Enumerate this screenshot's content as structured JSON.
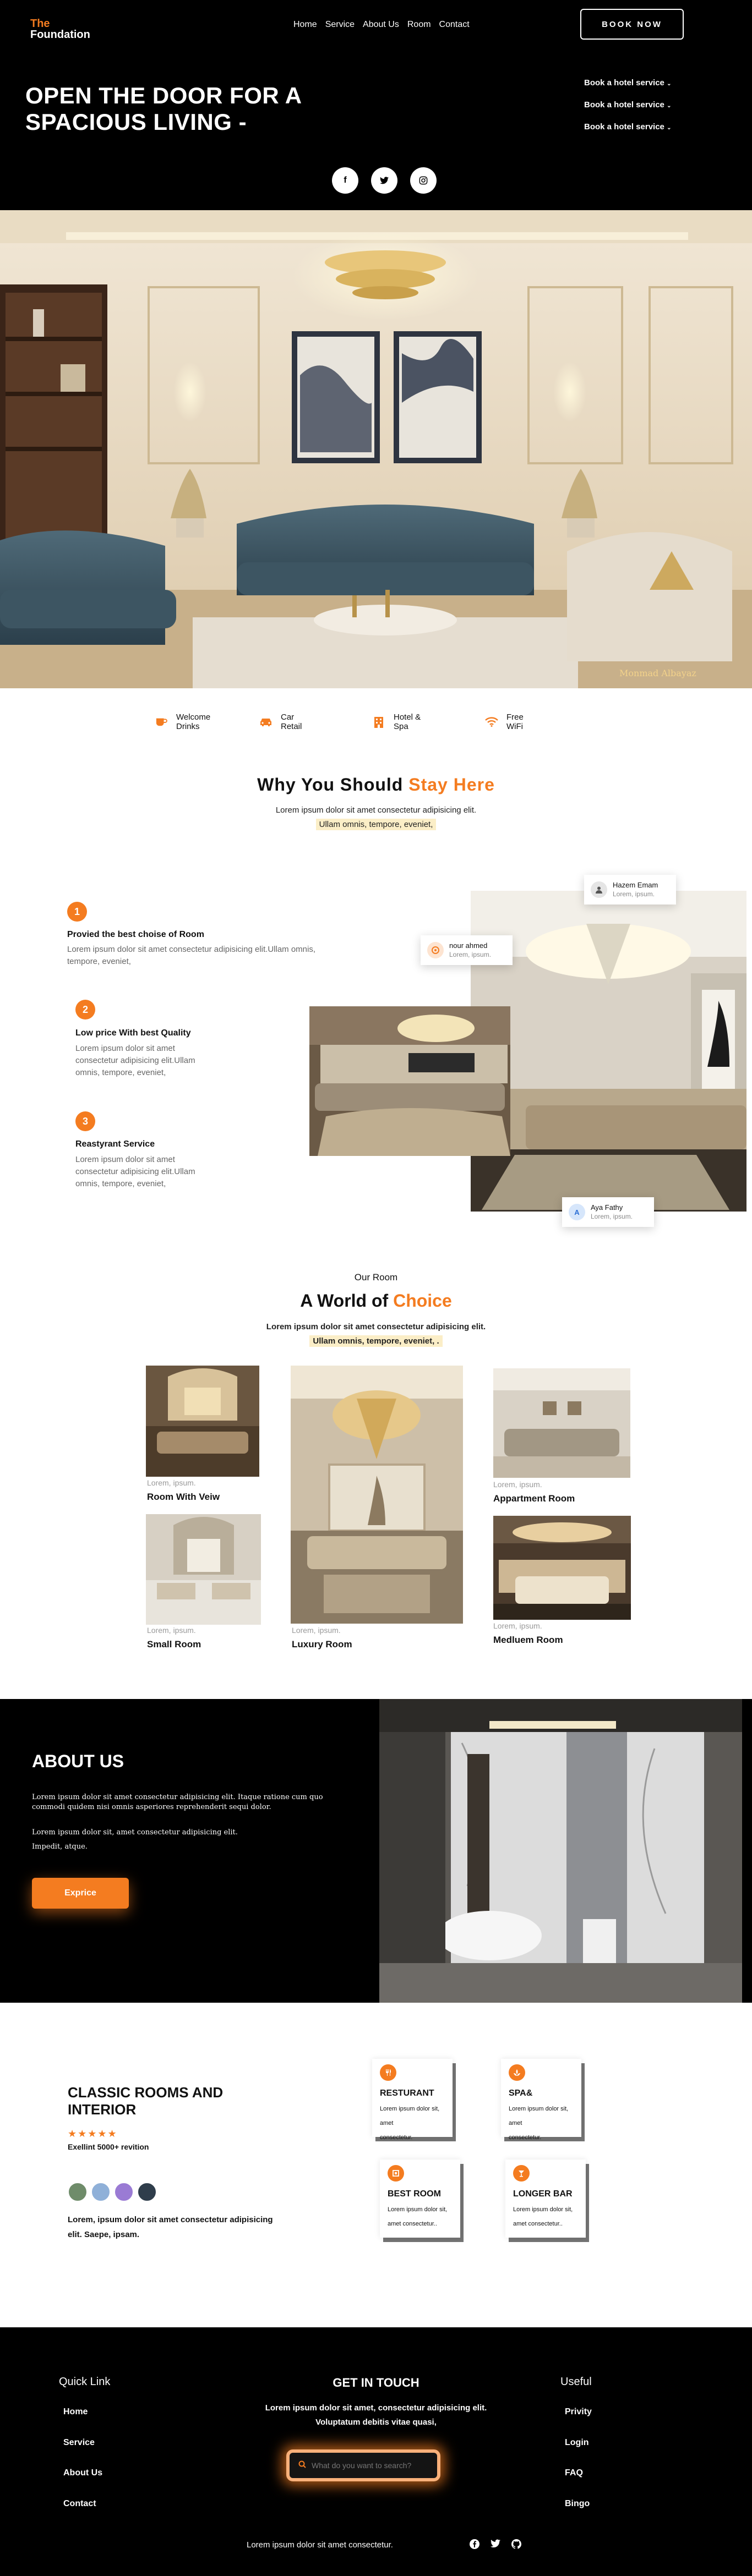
{
  "header": {
    "logo_the": "The",
    "logo_name": "Foundation",
    "nav": [
      "Home",
      "Service",
      "About Us",
      "Room",
      "Contact"
    ],
    "book_label": "BOOK NOW",
    "title": "OPEN THE DOOR FOR A SPACIOUS LIVING -",
    "services": [
      "Book a hotel service",
      "Book a hotel service",
      "Book a hotel service"
    ],
    "social_icons": [
      "facebook-icon",
      "twitter-icon",
      "instagram-icon"
    ]
  },
  "hero_image": {
    "watermark": "Monmad Albayaz"
  },
  "features": [
    {
      "icon": "cup-icon",
      "line1": "Welcome",
      "line2": "Drinks"
    },
    {
      "icon": "car-icon",
      "line1": "Car",
      "line2": "Retail"
    },
    {
      "icon": "hotel-icon",
      "line1": "Hotel &",
      "line2": "Spa"
    },
    {
      "icon": "wifi-icon",
      "line1": "Free",
      "line2": "WiFi"
    }
  ],
  "why": {
    "title_a": "Why You Should",
    "title_b": "Stay Here",
    "sub1": "Lorem ipsum dolor sit amet consectetur adipisicing elit.",
    "sub2": "Ullam omnis, tempore, eveniet,",
    "reasons": [
      {
        "num": "1",
        "title": "Provied the best choise of Room",
        "desc": "Lorem ipsum dolor sit amet consectetur adipisicing elit.Ullam omnis, tempore, eveniet,"
      },
      {
        "num": "2",
        "title": "Low price With best Quality",
        "desc": "Lorem ipsum dolor sit amet consectetur adipisicing elit.Ullam omnis, tempore, eveniet,"
      },
      {
        "num": "3",
        "title": "Reastyrant Service",
        "desc": "Lorem ipsum dolor sit amet consectetur adipisicing elit.Ullam omnis, tempore, eveniet,"
      }
    ],
    "reviewers": [
      {
        "name": "Hazem Emam",
        "text": "Lorem, ipsum."
      },
      {
        "name": "nour ahmed",
        "text": "Lorem, ipsum."
      },
      {
        "name": "Aya Fathy",
        "text": "Lorem, ipsum."
      }
    ]
  },
  "rooms": {
    "kicker": "Our Room",
    "title_a": "A World of",
    "title_b": "Choice",
    "sub1": "Lorem ipsum dolor sit amet consectetur adipisicing elit.",
    "sub2": "Ullam omnis, tempore, eveniet, .",
    "items": [
      {
        "cap": "Lorem, ipsum.",
        "name": "Room With Veiw"
      },
      {
        "cap": "Lorem, ipsum.",
        "name": "Small Room"
      },
      {
        "cap": "Lorem, ipsum.",
        "name": "Luxury Room"
      },
      {
        "cap": "Lorem, ipsum.",
        "name": "Appartment Room"
      },
      {
        "cap": "Lorem, ipsum.",
        "name": "Medluem Room"
      }
    ]
  },
  "about": {
    "title": "ABOUT US",
    "p1": "Lorem ipsum dolor sit amet consectetur adipisicing elit. Itaque ratione cum quo commodi quidem nisi omnis asperiores reprehenderit sequi dolor.",
    "p2a": "Lorem ipsum dolor sit, amet consectetur adipisicing elit.",
    "p2b": "Impedit, atque.",
    "button": "Exprice"
  },
  "classic": {
    "title_l1": "CLASSIC ROOMS AND",
    "title_l2": "INTERIOR",
    "rating": 5,
    "stars": "★★★★★",
    "revition": "Exellint 5000+ revition",
    "desc_l1": "Lorem, ipsum dolor sit amet consectetur adipisicing",
    "desc_l2": "elit. Saepe, ipsam.",
    "services": [
      {
        "icon": "restaurant-icon",
        "title": "RESTURANT",
        "l1": "Lorem ipsum dolor sit, amet",
        "l2": "consectetur."
      },
      {
        "icon": "spa-icon",
        "title": "SPA&",
        "l1": "Lorem ipsum dolor sit, amet",
        "l2": "consectetur."
      },
      {
        "icon": "room-icon",
        "title": "BEST ROOM",
        "l1": "Lorem ipsum dolor sit,",
        "l2": "amet consectetur.."
      },
      {
        "icon": "bar-icon",
        "title": "LONGER BAR",
        "l1": "Lorem ipsum dolor sit,",
        "l2": "amet consectetur.."
      }
    ]
  },
  "footer": {
    "quick_title": "Quick Link",
    "quick": [
      "Home",
      "Service",
      "About Us",
      "Contact"
    ],
    "touch_title": "GET IN TOUCH",
    "touch_l1": "Lorem ipsum dolor sit amet, consectetur adipisicing elit.",
    "touch_l2": "Voluptatum debitis vitae quasi,",
    "search_placeholder": "What do you want to search?",
    "useful_title": "Useful",
    "useful": [
      "Privity",
      "Login",
      "FAQ",
      "Bingo"
    ],
    "bottom": "Lorem ipsum dolor sit amet consectetur.",
    "social_icons": [
      "facebook-icon",
      "twitter-icon",
      "github-icon"
    ]
  },
  "colors": {
    "accent": "#f47c20",
    "dark": "#000000"
  }
}
